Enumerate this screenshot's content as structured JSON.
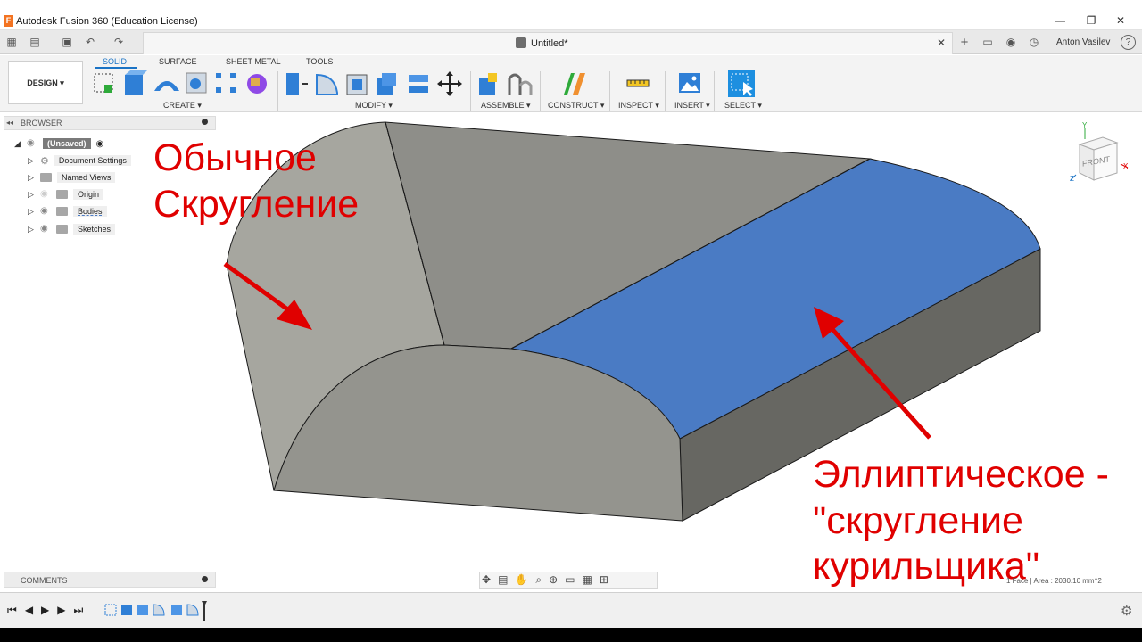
{
  "window": {
    "title": "Autodesk Fusion 360 (Education License)",
    "logo_letter": "F"
  },
  "document_tab": {
    "label": "Untitled*"
  },
  "user": {
    "name": "Anton Vasilev"
  },
  "workspace_button": "DESIGN ▾",
  "ribbon": {
    "tabs": [
      "SOLID",
      "SURFACE",
      "SHEET METAL",
      "TOOLS"
    ],
    "groups": [
      "CREATE ▾",
      "MODIFY ▾",
      "ASSEMBLE ▾",
      "CONSTRUCT ▾",
      "INSPECT ▾",
      "INSERT ▾",
      "SELECT ▾"
    ]
  },
  "browser": {
    "title": "BROWSER",
    "root": "(Unsaved)",
    "items": [
      "Document Settings",
      "Named Views",
      "Origin",
      "Bodies",
      "Sketches"
    ]
  },
  "comments": {
    "title": "COMMENTS"
  },
  "status": {
    "text": "1 Face | Area : 2030.10 mm^2"
  },
  "viewcube": {
    "face_label": "FRONT",
    "axis_y": "Y",
    "axis_x": "X",
    "axis_z": "Z"
  },
  "annotations": {
    "left_line1": "Обычное",
    "left_line2": "Скругление",
    "right_line1": "Эллиптическое -",
    "right_line2": "\"скругление",
    "right_line3": "курильщика\""
  },
  "colors": {
    "model_gray": "#9a9a92",
    "model_side": "#666661",
    "selected_face": "#4a7bc4",
    "annotation_red": "#e00000",
    "accent_blue": "#1a73c5"
  }
}
